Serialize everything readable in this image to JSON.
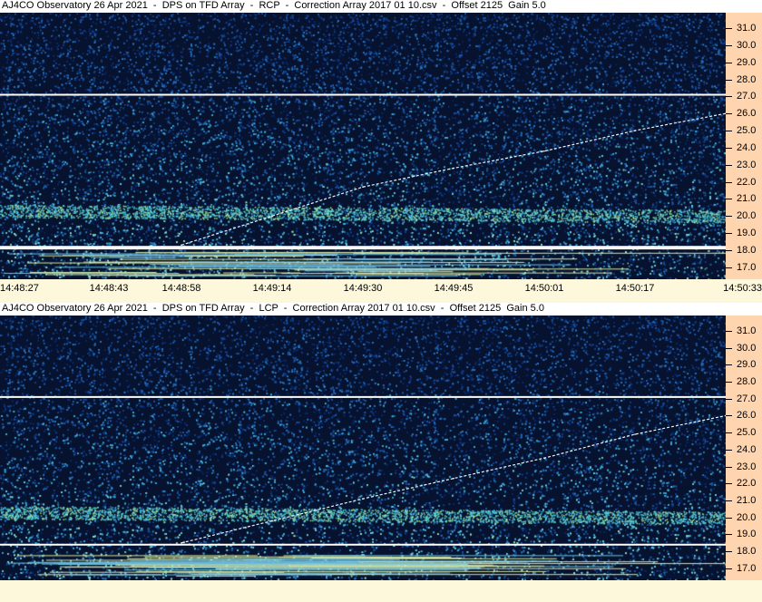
{
  "panels": [
    {
      "title": "AJ4CO Observatory 26 Apr 2021  -  DPS on TFD Array  -  RCP  -  Correction Array 2017 01 10.csv  -  Offset 2125  Gain 5.0",
      "polarization": "RCP"
    },
    {
      "title": "AJ4CO Observatory 26 Apr 2021  -  DPS on TFD Array  -  LCP  -  Correction Array 2017 01 10.csv  -  Offset 2125  Gain 5.0",
      "polarization": "LCP"
    }
  ],
  "freq_ticks": [
    "31.0",
    "30.0",
    "29.0",
    "28.0",
    "27.0",
    "26.0",
    "25.0",
    "24.0",
    "23.0",
    "22.0",
    "21.0",
    "20.0",
    "19.0",
    "18.0",
    "17.0"
  ],
  "time_ticks": [
    "14:48:27",
    "14:48:43",
    "14:48:58",
    "14:49:14",
    "14:49:30",
    "14:49:45",
    "14:50:01",
    "14:50:17",
    "14:50:33"
  ],
  "colors": {
    "background_noise": "#06122e",
    "noise_mid": "#1e5aa8",
    "noise_high": "#3fb0d8",
    "rfi_line": "#ffffff",
    "freq_axis_bg": "#ffd5b0",
    "page_bg": "#fdf7dc"
  },
  "chart_data": [
    {
      "type": "heatmap",
      "title": "AJ4CO Observatory 26 Apr 2021  -  DPS on TFD Array  -  RCP  -  Correction Array 2017 01 10.csv  -  Offset 2125  Gain 5.0",
      "xlabel": "",
      "ylabel": "",
      "x_ticks": [
        "14:48:27",
        "14:48:43",
        "14:48:58",
        "14:49:14",
        "14:49:30",
        "14:49:45",
        "14:50:01",
        "14:50:17",
        "14:50:33"
      ],
      "y_ticks": [
        31.0,
        30.0,
        29.0,
        28.0,
        27.0,
        26.0,
        25.0,
        24.0,
        23.0,
        22.0,
        21.0,
        20.0,
        19.0,
        18.0,
        17.0
      ],
      "ylim": [
        16.3,
        31.9
      ],
      "rfi_lines_mhz": [
        27.1,
        18.1,
        18.2
      ],
      "drift_trace": [
        {
          "time": "14:48:58",
          "mhz": 18.3
        },
        {
          "time": "14:49:14",
          "mhz": 20.0
        },
        {
          "time": "14:49:30",
          "mhz": 21.7
        },
        {
          "time": "14:49:45",
          "mhz": 22.8
        },
        {
          "time": "14:50:01",
          "mhz": 23.8
        },
        {
          "time": "14:50:17",
          "mhz": 25.0
        },
        {
          "time": "14:50:33",
          "mhz": 26.0
        }
      ]
    },
    {
      "type": "heatmap",
      "title": "AJ4CO Observatory 26 Apr 2021  -  DPS on TFD Array  -  LCP  -  Correction Array 2017 01 10.csv  -  Offset 2125  Gain 5.0",
      "xlabel": "",
      "ylabel": "",
      "y_ticks": [
        31.0,
        30.0,
        29.0,
        28.0,
        27.0,
        26.0,
        25.0,
        24.0,
        23.0,
        22.0,
        21.0,
        20.0,
        19.0,
        18.0,
        17.0
      ],
      "ylim": [
        16.3,
        31.9
      ],
      "rfi_lines_mhz": [
        27.1,
        18.4
      ],
      "drift_trace": [
        {
          "time": "14:48:58",
          "mhz": 18.5
        },
        {
          "time": "14:49:14",
          "mhz": 19.8
        },
        {
          "time": "14:49:30",
          "mhz": 21.1
        },
        {
          "time": "14:49:45",
          "mhz": 22.3
        },
        {
          "time": "14:50:01",
          "mhz": 23.5
        },
        {
          "time": "14:50:17",
          "mhz": 24.9
        },
        {
          "time": "14:50:33",
          "mhz": 26.0
        }
      ]
    }
  ]
}
